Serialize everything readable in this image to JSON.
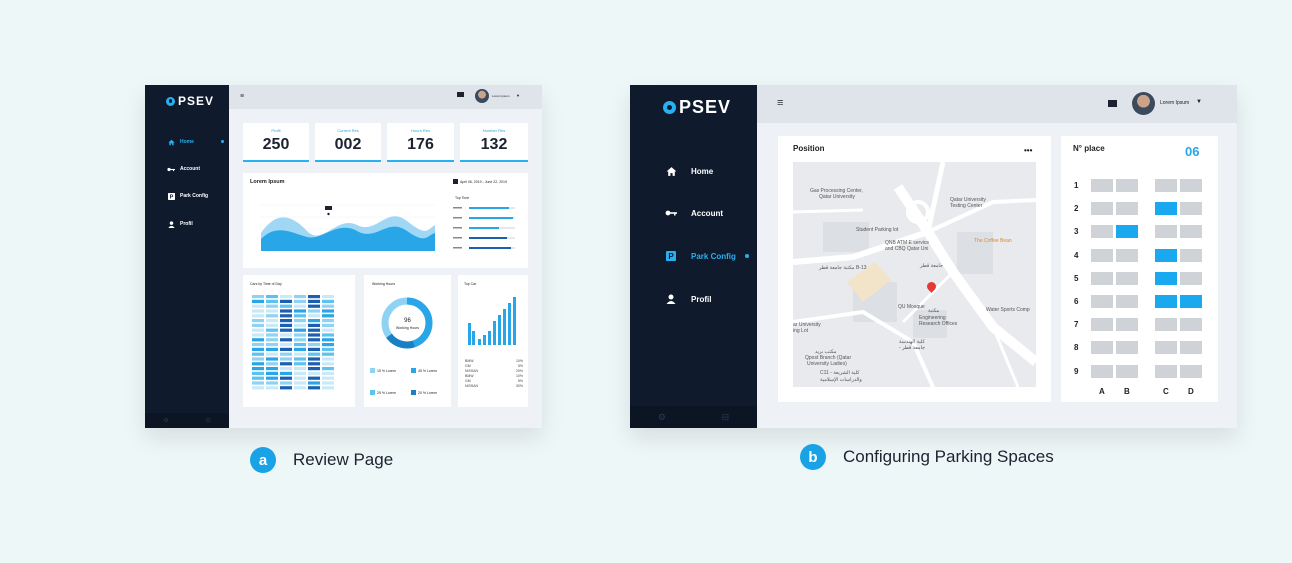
{
  "panel_a": {
    "brand": "PSEV",
    "nav": [
      {
        "label": "Home",
        "icon": "home-icon",
        "active": true
      },
      {
        "label": "Account",
        "icon": "key-icon",
        "active": false
      },
      {
        "label": "Park Config",
        "icon": "parking-icon",
        "active": false
      },
      {
        "label": "Profil",
        "icon": "user-icon",
        "active": false
      }
    ],
    "user_name": "Lorem Ipsum",
    "stats": [
      {
        "label": "Profit",
        "value": "250"
      },
      {
        "label": "Current Res",
        "value": "002"
      },
      {
        "label": "Hours Res",
        "value": "176"
      },
      {
        "label": "Number Res",
        "value": "132"
      }
    ],
    "chart_title": "Lorem Ipsum",
    "date_range": "April 06, 2019 - June 22, 2019",
    "top_time_title": "Top Time",
    "cars_title": "Cars by Time of Day",
    "working_title": "Working Hours",
    "working_value": "96",
    "working_label": "Working Hours",
    "legend": [
      {
        "label": "15 % Lorem",
        "color": "#8fd3f4"
      },
      {
        "label": "45 % Lorem",
        "color": "#28a6e8"
      },
      {
        "label": "25 % Lorem",
        "color": "#5cc2f0"
      },
      {
        "label": "20 % Lorem",
        "color": "#1b7fc4"
      }
    ],
    "top_car_title": "Top Car",
    "top_cars": [
      {
        "name": "BMW",
        "pct": "10%"
      },
      {
        "name": "GM",
        "pct": "5%"
      },
      {
        "name": "NISSAN",
        "pct": "20%"
      },
      {
        "name": "BMW",
        "pct": "10%"
      },
      {
        "name": "GM",
        "pct": "5%"
      },
      {
        "name": "NISSAN",
        "pct": "30%"
      }
    ]
  },
  "panel_b": {
    "brand": "PSEV",
    "nav": [
      {
        "label": "Home",
        "icon": "home-icon",
        "active": false
      },
      {
        "label": "Account",
        "icon": "key-icon",
        "active": false
      },
      {
        "label": "Park Config",
        "icon": "parking-icon",
        "active": true
      },
      {
        "label": "Profil",
        "icon": "user-icon",
        "active": false
      }
    ],
    "user_name": "Lorem Ipsum",
    "position_title": "Position",
    "more_label": "•••",
    "map_labels": {
      "gas": "Gas Processing Center,",
      "gas2": "Qatar University",
      "testing": "Qatar University",
      "testing2": "Testing Center",
      "student": "Student Parking lot",
      "qnb": "QNB ATM E service",
      "qnb2": "and CBQ Qatar Uni",
      "coffee": "The Coffee Bean",
      "b13": "مكتبة جامعة قطر B-13",
      "jamea": "جامعة قطر",
      "mosque": "QU Mosque",
      "maktaba": "مكتبة",
      "eng": "Engineering",
      "eng2": "Research Offices",
      "water": "Water Sports Comp",
      "univ": "ar University",
      "univ2": "ing Lot",
      "handasa": "كلية الهندسة",
      "handasa2": "- جامعة قطر",
      "sport": "مكتب بريد",
      "sport2": "Qpost Branch (Qatar",
      "sport3": "University Ladies)",
      "c11": "C11 - كلية الشريعة",
      "c11b": "والدراسات الإسلامية"
    },
    "place_label": "N° place",
    "place_count": "06",
    "rows": [
      "1",
      "2",
      "3",
      "4",
      "5",
      "6",
      "7",
      "8",
      "9"
    ],
    "columns": [
      "A",
      "B",
      "C",
      "D"
    ],
    "occupied": [
      [
        1,
        2
      ],
      [
        2,
        1
      ],
      [
        3,
        2
      ],
      [
        4,
        2
      ],
      [
        5,
        2
      ],
      [
        5,
        3
      ]
    ]
  },
  "captions": [
    {
      "badge": "a",
      "text": "Review Page"
    },
    {
      "badge": "b",
      "text": "Configuring Parking Spaces"
    }
  ],
  "colors": {
    "accent": "#28b0f0",
    "sidebar": "#0f1b2d",
    "slot": "#cfd3d8"
  }
}
